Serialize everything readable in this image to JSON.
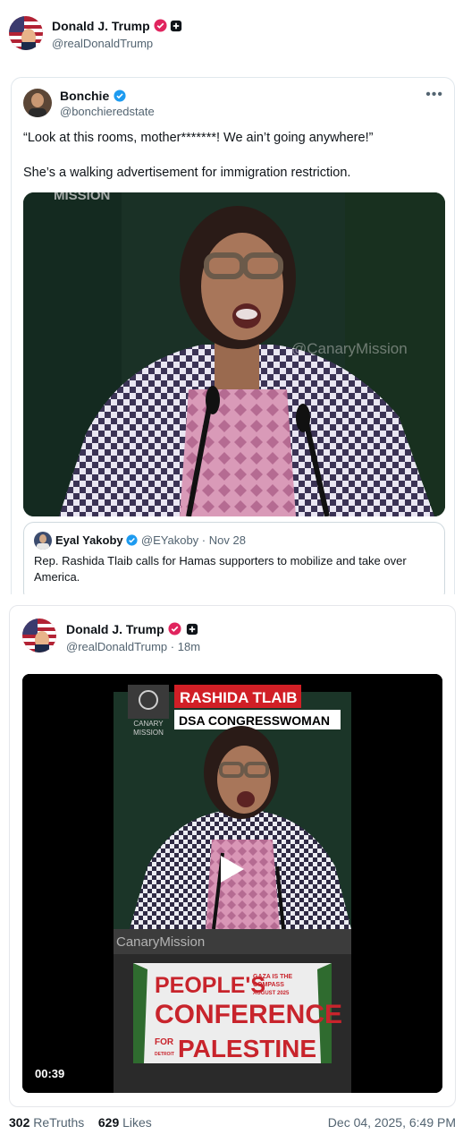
{
  "header": {
    "name": "Donald J. Trump",
    "handle": "@realDonaldTrump"
  },
  "tweet": {
    "author_name": "Bonchie",
    "author_handle": "@bonchieredstate",
    "more_icon": "more-horizontal-icon",
    "text_line1": "“Look at this rooms, mother*******! We ain’t going anywhere!”",
    "text_line2": "She’s a walking advertisement for immigration restriction.",
    "media_watermark_top": "MISSION",
    "media_watermark_mid": "@CanaryMission",
    "quoted": {
      "author_name": "Eyal Yakoby",
      "author_handle": "@EYakoby",
      "separator": "·",
      "date": "Nov 28",
      "text": "Rep. Rashida Tlaib calls for Hamas supporters to mobilize and take over America."
    }
  },
  "truth": {
    "name": "Donald J. Trump",
    "handle": "@realDonaldTrump",
    "separator": "·",
    "time_ago": "18m",
    "video": {
      "banner_name": "RASHIDA TLAIB",
      "banner_title": "DSA CONGRESSWOMAN",
      "logo_line1": "CANARY",
      "logo_line2": "MISSION",
      "watermark": "CanaryMission",
      "sign_line1": "PEOPLE'S",
      "sign_line2": "CONFERENCE",
      "sign_for": "FOR",
      "sign_line3": "PALESTINE",
      "sign_small1": "GAZA IS THE",
      "sign_small2": "COMPASS",
      "sign_small3": "AUGUST 2025",
      "sign_detroit": "DETROIT",
      "duration": "00:39",
      "play_icon": "play-icon"
    }
  },
  "footer": {
    "retruths_count": "302",
    "retruths_label": "ReTruths",
    "likes_count": "629",
    "likes_label": "Likes",
    "date": "Dec 04, 2025, 6:49 PM"
  },
  "colors": {
    "verified_pink": "#e0245e",
    "verified_blue": "#1d9bf0",
    "banner_red": "#d11f26",
    "sign_red": "#c8242c"
  }
}
